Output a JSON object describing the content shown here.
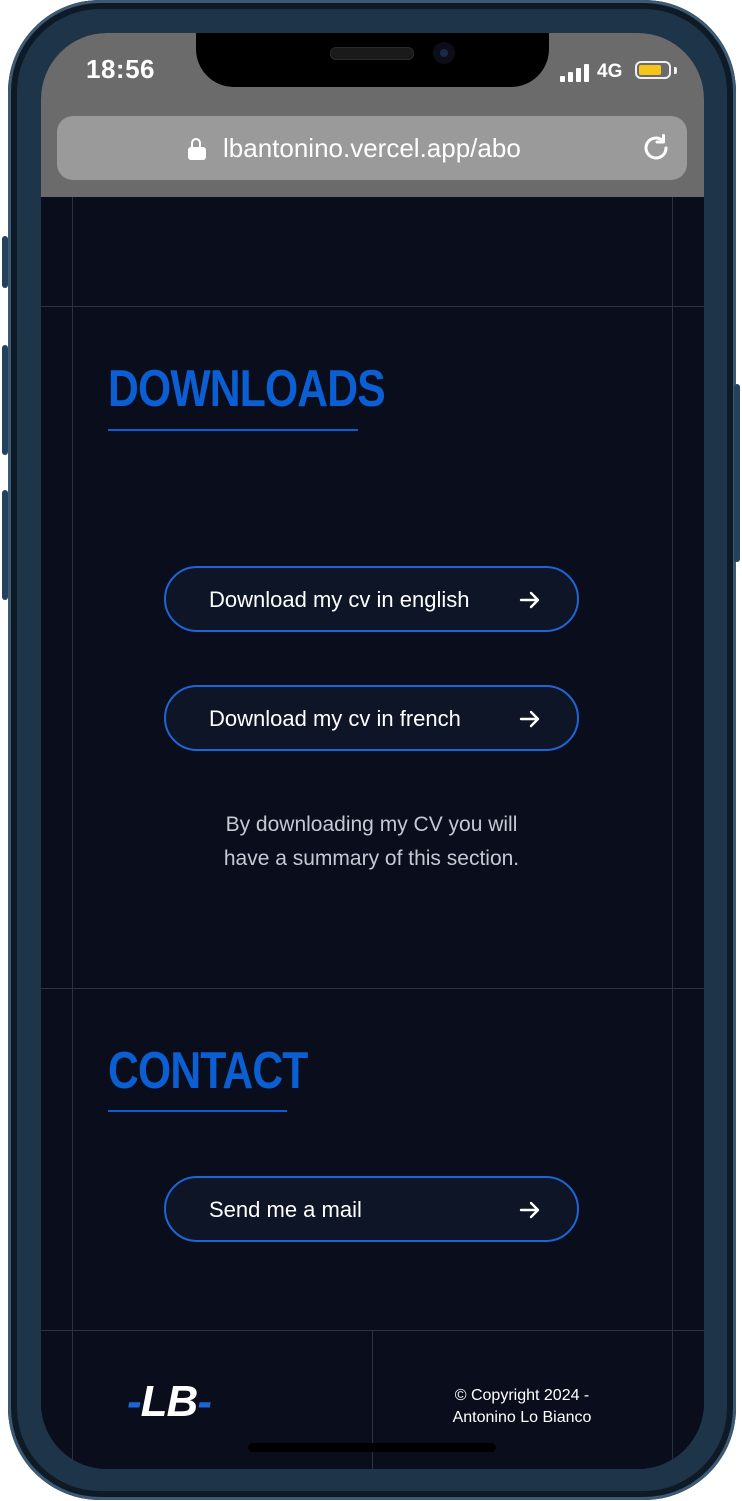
{
  "status_bar": {
    "time": "18:56",
    "network": "4G",
    "battery_color": "#f5c518",
    "icons": [
      "signal-bars-icon",
      "battery-icon"
    ]
  },
  "browser": {
    "url": "lbantonino.vercel.app/abo",
    "icons": [
      "lock-icon",
      "reload-icon"
    ]
  },
  "downloads": {
    "title": "DOWNLOADS",
    "buttons": [
      {
        "label": "Download my cv in english",
        "icon": "arrow-right-icon"
      },
      {
        "label": "Download my cv in french",
        "icon": "arrow-right-icon"
      }
    ],
    "note_line1": "By downloading my CV you will",
    "note_line2": "have a summary of this section."
  },
  "contact": {
    "title": "CONTACT",
    "button": {
      "label": "Send me a mail",
      "icon": "arrow-right-icon"
    }
  },
  "footer": {
    "logo_dash_left": "-",
    "logo_text": "LB",
    "logo_dash_right": "-",
    "copyright_line1": "© Copyright 2024 -",
    "copyright_line2": "Antonino Lo Bianco"
  },
  "colors": {
    "accent": "#0b5fd3",
    "background": "#0a0e1c",
    "button_border": "#1e64d4"
  }
}
